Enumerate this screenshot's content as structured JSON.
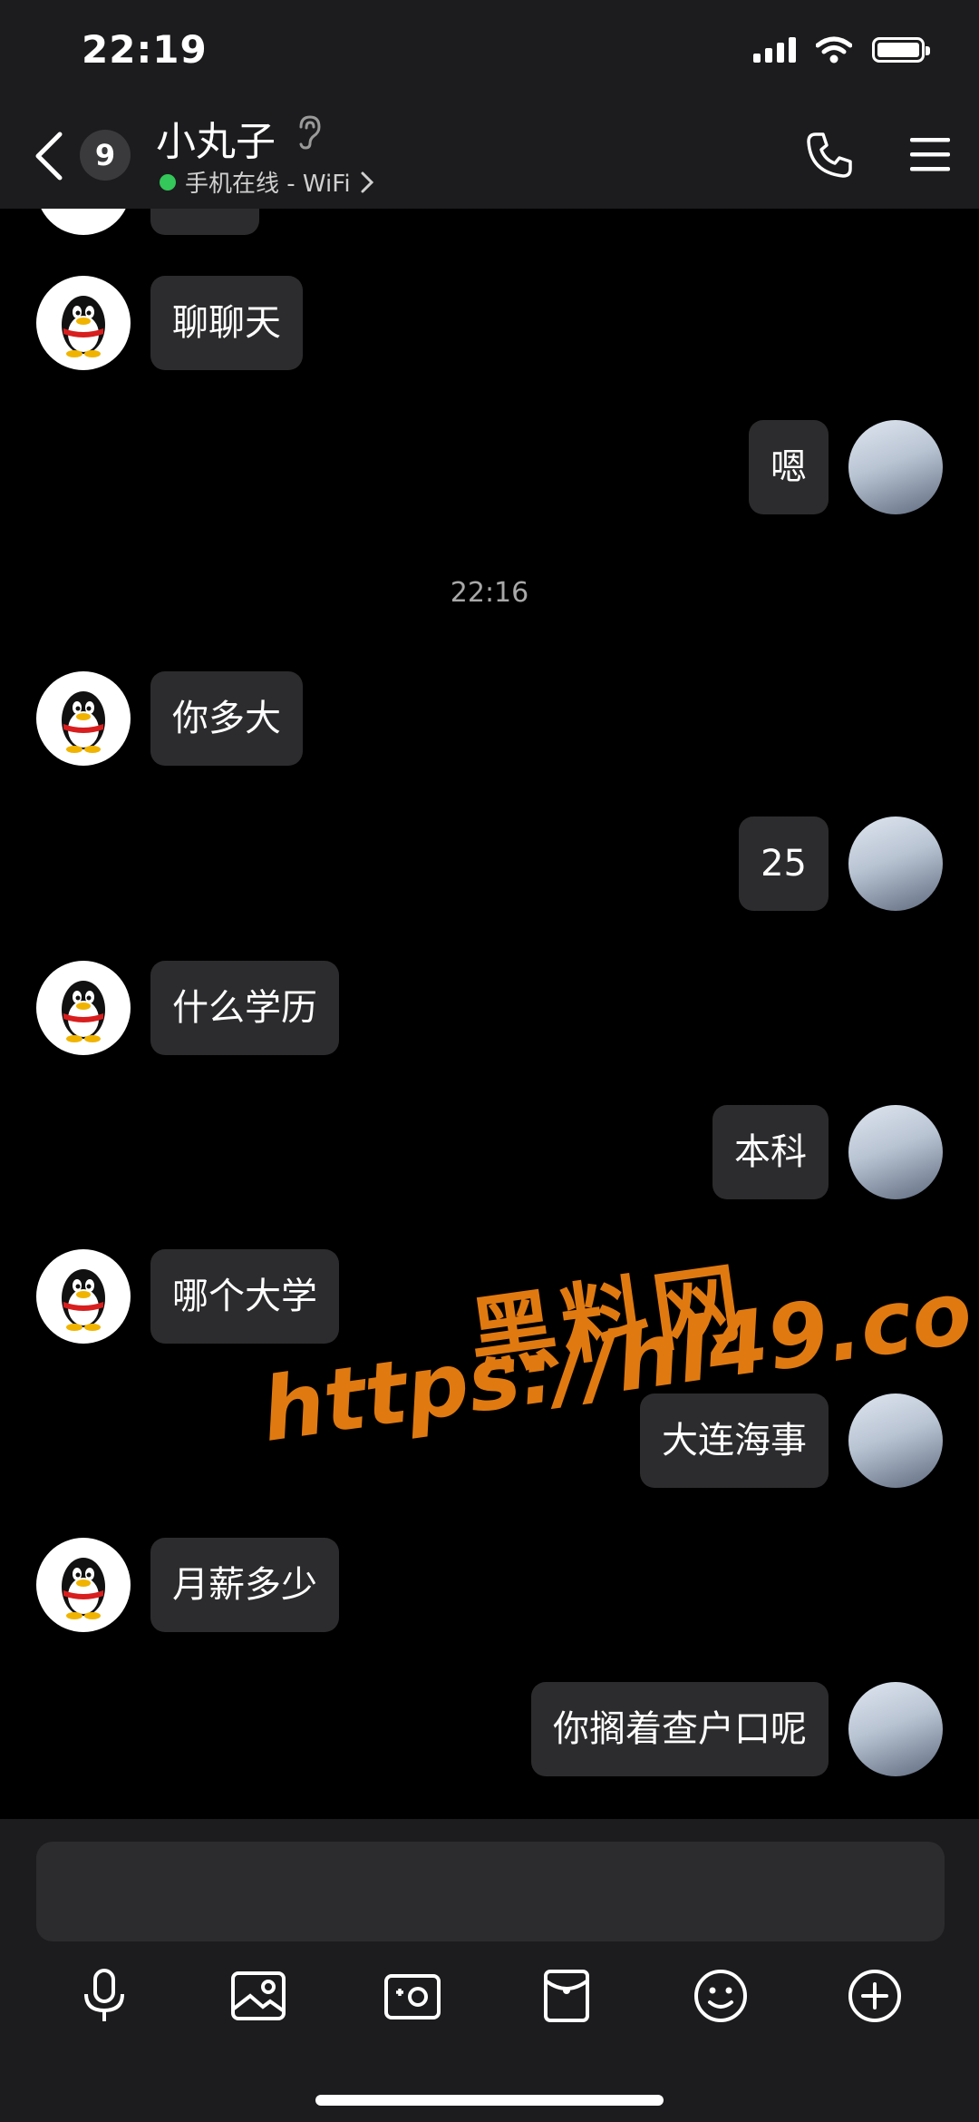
{
  "status_bar": {
    "time": "22:19"
  },
  "header": {
    "unread_count": "9",
    "contact_name": "小丸子",
    "status_text": "手机在线 - WiFi",
    "status_color": "#34c759"
  },
  "messages": [
    {
      "side": "left",
      "text": "聊聊天"
    },
    {
      "side": "right",
      "text": "嗯"
    },
    {
      "type": "time",
      "text": "22:16"
    },
    {
      "side": "left",
      "text": "你多大"
    },
    {
      "side": "right",
      "text": "25"
    },
    {
      "side": "left",
      "text": "什么学历"
    },
    {
      "side": "right",
      "text": "本科"
    },
    {
      "side": "left",
      "text": "哪个大学"
    },
    {
      "side": "right",
      "text": "大连海事"
    },
    {
      "side": "left",
      "text": "月薪多少"
    },
    {
      "side": "right",
      "text": "你搁着查户口呢"
    }
  ],
  "watermark": {
    "line1": "黑料网",
    "line2": "https://hl49.co"
  },
  "composer": {
    "placeholder": ""
  },
  "toolbar_icons": [
    "microphone-icon",
    "image-icon",
    "camera-icon",
    "red-packet-icon",
    "emoji-icon",
    "plus-icon"
  ],
  "colors": {
    "bubble": "#2c2c2e",
    "background": "#000000",
    "bar": "#1c1c1e",
    "watermark": "#e07a10"
  }
}
